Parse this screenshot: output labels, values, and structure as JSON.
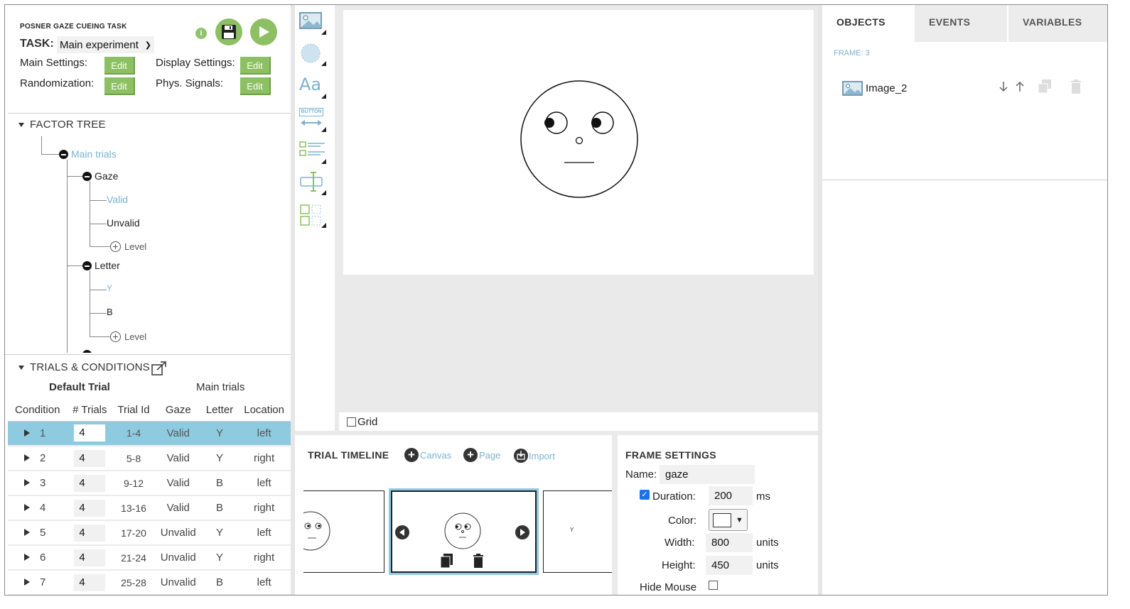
{
  "header": {
    "experiment_title": "POSNER GAZE CUEING TASK",
    "task_label": "TASK:",
    "task_value": "Main experiment",
    "main_settings_label": "Main Settings:",
    "display_settings_label": "Display Settings:",
    "randomization_label": "Randomization:",
    "phys_signals_label": "Phys. Signals:",
    "edit_label": "Edit",
    "info_glyph": "i"
  },
  "factor_tree": {
    "title": "FACTOR TREE",
    "root": "Main trials",
    "gaze": {
      "name": "Gaze",
      "levels": [
        "Valid",
        "Unvalid"
      ]
    },
    "letter": {
      "name": "Letter",
      "levels": [
        "Y",
        "B"
      ]
    },
    "add_level": "Level"
  },
  "trials": {
    "title": "TRIALS & CONDITIONS",
    "default_trial": "Default Trial",
    "group_name": "Main trials",
    "columns": [
      "Condition",
      "# Trials",
      "Trial Id",
      "Gaze",
      "Letter",
      "Location"
    ],
    "rows": [
      {
        "condition": "1",
        "trials": "4",
        "trial_id": "1-4",
        "gaze": "Valid",
        "letter": "Y",
        "location": "left"
      },
      {
        "condition": "2",
        "trials": "4",
        "trial_id": "5-8",
        "gaze": "Valid",
        "letter": "Y",
        "location": "right"
      },
      {
        "condition": "3",
        "trials": "4",
        "trial_id": "9-12",
        "gaze": "Valid",
        "letter": "B",
        "location": "left"
      },
      {
        "condition": "4",
        "trials": "4",
        "trial_id": "13-16",
        "gaze": "Valid",
        "letter": "B",
        "location": "right"
      },
      {
        "condition": "5",
        "trials": "4",
        "trial_id": "17-20",
        "gaze": "Unvalid",
        "letter": "Y",
        "location": "left"
      },
      {
        "condition": "6",
        "trials": "4",
        "trial_id": "21-24",
        "gaze": "Unvalid",
        "letter": "Y",
        "location": "right"
      },
      {
        "condition": "7",
        "trials": "4",
        "trial_id": "25-28",
        "gaze": "Unvalid",
        "letter": "B",
        "location": "left"
      }
    ]
  },
  "canvas": {
    "grid_label": "Grid",
    "button_tool_text": "BUTTON",
    "text_tool_text": "Aa"
  },
  "timeline": {
    "title": "TRIAL TIMELINE",
    "canvas_label": "Canvas",
    "page_label": "Page",
    "import_label": "Import",
    "next_frame_text": "Y"
  },
  "frame_settings": {
    "title": "FRAME SETTINGS",
    "name_label": "Name:",
    "name_value": "gaze",
    "duration_label": "Duration:",
    "duration_value": "200",
    "duration_unit": "ms",
    "color_label": "Color:",
    "color_arrow": "▼",
    "width_label": "Width:",
    "width_value": "800",
    "height_label": "Height:",
    "height_value": "450",
    "units_label": "units",
    "hide_mouse_label": "Hide Mouse"
  },
  "right_panel": {
    "tabs": [
      "OBJECTS",
      "EVENTS",
      "VARIABLES"
    ],
    "frame_label": "FRAME: 3",
    "object_name": "Image_2"
  },
  "colors": {
    "accent_green": "#8cc063",
    "selected_row": "#8fcbe0",
    "link_blue": "#7bb3cf"
  }
}
